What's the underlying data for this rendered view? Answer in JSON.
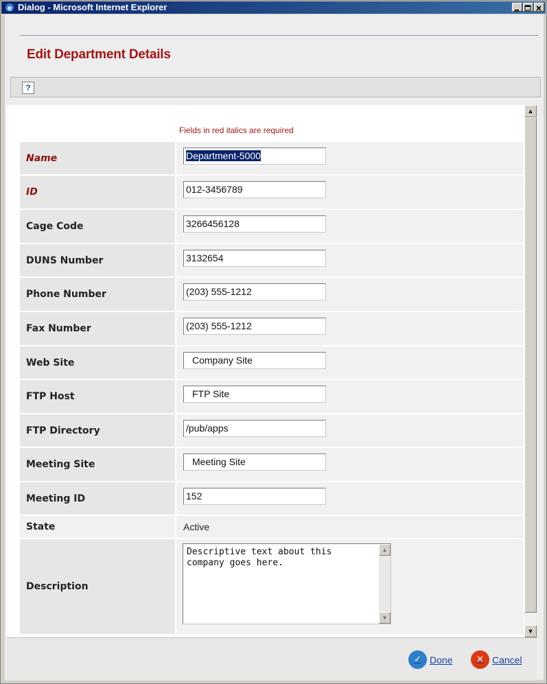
{
  "window": {
    "title": "Dialog - Microsoft Internet Explorer",
    "controls": {
      "minimize": "_",
      "maximize": "□",
      "close": "×"
    }
  },
  "header": {
    "title": "Edit Department Details"
  },
  "toolbar": {
    "help_icon": "?"
  },
  "form": {
    "required_note": "Fields in red italics are required",
    "fields": [
      {
        "label": "Name",
        "value": "Department-5000",
        "required": true
      },
      {
        "label": "ID",
        "value": "012-3456789",
        "required": true
      },
      {
        "label": "Cage Code",
        "value": "3266456128",
        "required": false
      },
      {
        "label": "DUNS Number",
        "value": "3132654",
        "required": false
      },
      {
        "label": "Phone Number",
        "value": "(203) 555-1212",
        "required": false
      },
      {
        "label": "Fax Number",
        "value": "(203) 555-1212",
        "required": false
      },
      {
        "label": "Web Site",
        "value": "Company Site",
        "required": false
      },
      {
        "label": "FTP Host",
        "value": "FTP Site",
        "required": false
      },
      {
        "label": "FTP Directory",
        "value": "/pub/apps",
        "required": false
      },
      {
        "label": "Meeting Site",
        "value": "Meeting Site",
        "required": false
      },
      {
        "label": "Meeting ID",
        "value": "152",
        "required": false
      }
    ],
    "state": {
      "label": "State",
      "value": "Active"
    },
    "description": {
      "label": "Description",
      "value": "Descriptive text about this company goes here."
    }
  },
  "footer": {
    "done_label": "Done",
    "cancel_label": "Cancel"
  },
  "icons": {
    "done": "check-circle-icon",
    "cancel": "x-circle-icon",
    "help": "help-icon"
  },
  "colors": {
    "title_bar": "#0a246a",
    "heading": "#a01616",
    "link": "#1a3fa8",
    "done_icon": "#2f7fc8",
    "cancel_icon": "#d93a16"
  }
}
